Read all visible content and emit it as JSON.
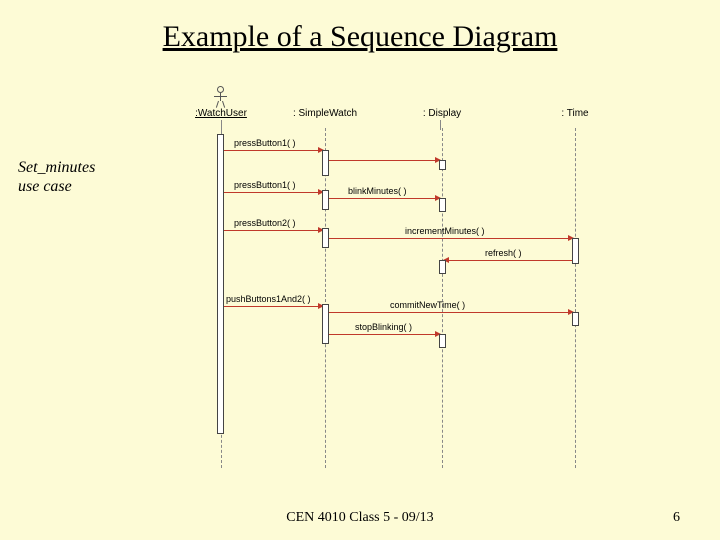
{
  "title": "Example of a Sequence Diagram",
  "caption_line1": "Set_minutes",
  "caption_line2": "use case",
  "footer_center": "CEN 4010 Class 5 - 09/13",
  "footer_page": "6",
  "participants": {
    "actor": ":WatchUser",
    "p1": ": SimpleWatch",
    "p2": ": Display",
    "p3": ": Time"
  },
  "messages": {
    "m1": "pressButton1( )",
    "m2": "pressButton1( )",
    "m3": "blinkMinutes( )",
    "m4": "pressButton2( )",
    "m5": "incrementMinutes( )",
    "m6": "refresh( )",
    "m7": "pushButtons1And2( )",
    "m8": "commitNewTime( )",
    "m9": "stopBlinking( )"
  }
}
